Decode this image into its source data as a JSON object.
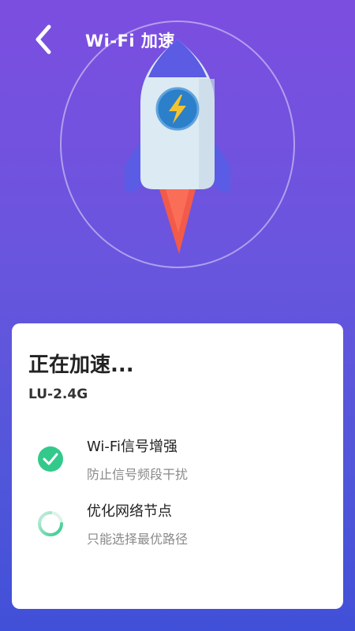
{
  "header": {
    "title": "Wi-Fi 加速",
    "back_icon": "chevron-left-icon"
  },
  "hero": {
    "rocket_icon": "rocket-icon",
    "bolt_icon": "lightning-bolt-icon",
    "colors": {
      "background_top": "#7C4EE0",
      "background_bottom": "#4150D8",
      "rocket_body": "#DCEAF2",
      "rocket_fin": "#5B5BE3",
      "flame": "#F25A4A",
      "badge": "#2C7FC9",
      "bolt": "#F4C330"
    }
  },
  "card": {
    "title": "正在加速...",
    "network_name": "LU-2.4G",
    "tasks": [
      {
        "title": "Wi-Fi信号增强",
        "subtitle": "防止信号频段干扰",
        "status": "done",
        "icon": "check-circle-icon"
      },
      {
        "title": "优化网络节点",
        "subtitle": "只能选择最优路径",
        "status": "in-progress",
        "icon": "loading-spinner-icon"
      }
    ],
    "accent_color": "#33C98B"
  }
}
